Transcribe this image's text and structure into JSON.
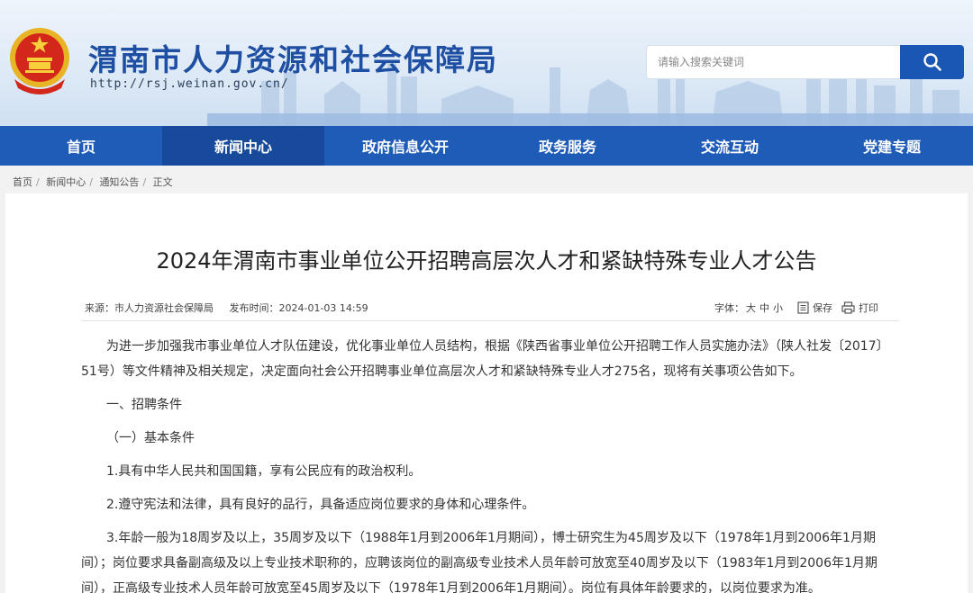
{
  "header": {
    "title": "渭南市人力资源和社会保障局",
    "url": "http://rsj.weinan.gov.cn/",
    "search_placeholder": "请输入搜索关键词"
  },
  "nav": {
    "items": [
      {
        "label": "首页"
      },
      {
        "label": "新闻中心"
      },
      {
        "label": "政府信息公开"
      },
      {
        "label": "政务服务"
      },
      {
        "label": "交流互动"
      },
      {
        "label": "党建专题"
      }
    ],
    "active_index": 1
  },
  "breadcrumb": [
    "首页",
    "新闻中心",
    "通知公告",
    "正文"
  ],
  "article": {
    "title": "2024年渭南市事业单位公开招聘高层次人才和紧缺特殊专业人才公告",
    "source": "来源：市人力资源社会保障局",
    "publish_time": "发布时间：2024-01-03 14:59",
    "font_size_label": "字体：",
    "font_sizes": [
      "大",
      "中",
      "小"
    ],
    "save_label": "保存",
    "print_label": "打印",
    "paragraphs": [
      "为进一步加强我市事业单位人才队伍建设，优化事业单位人员结构，根据《陕西省事业单位公开招聘工作人员实施办法》（陕人社发〔2017〕51号）等文件精神及相关规定，决定面向社会公开招聘事业单位高层次人才和紧缺特殊专业人才275名，现将有关事项公告如下。",
      "一、招聘条件",
      "（一）基本条件",
      "1.具有中华人民共和国国籍，享有公民应有的政治权利。",
      "2.遵守宪法和法律，具有良好的品行，具备适应岗位要求的身体和心理条件。",
      "3.年龄一般为18周岁及以上，35周岁及以下（1988年1月到2006年1月期间），博士研究生为45周岁及以下（1978年1月到2006年1月期间）；岗位要求具备副高级及以上专业技术职称的，应聘该岗位的副高级专业技术人员年龄可放宽至40周岁及以下（1983年1月到2006年1月期间），正高级专业技术人员年龄可放宽至45周岁及以下（1978年1月到2006年1月期间）。岗位有具体年龄要求的，以岗位要求为准。"
    ]
  },
  "colors": {
    "nav_bg": "#1f5cb8",
    "nav_active": "#174a9a",
    "title_blue": "#1e4fa3",
    "search_btn": "#1a56b3"
  }
}
